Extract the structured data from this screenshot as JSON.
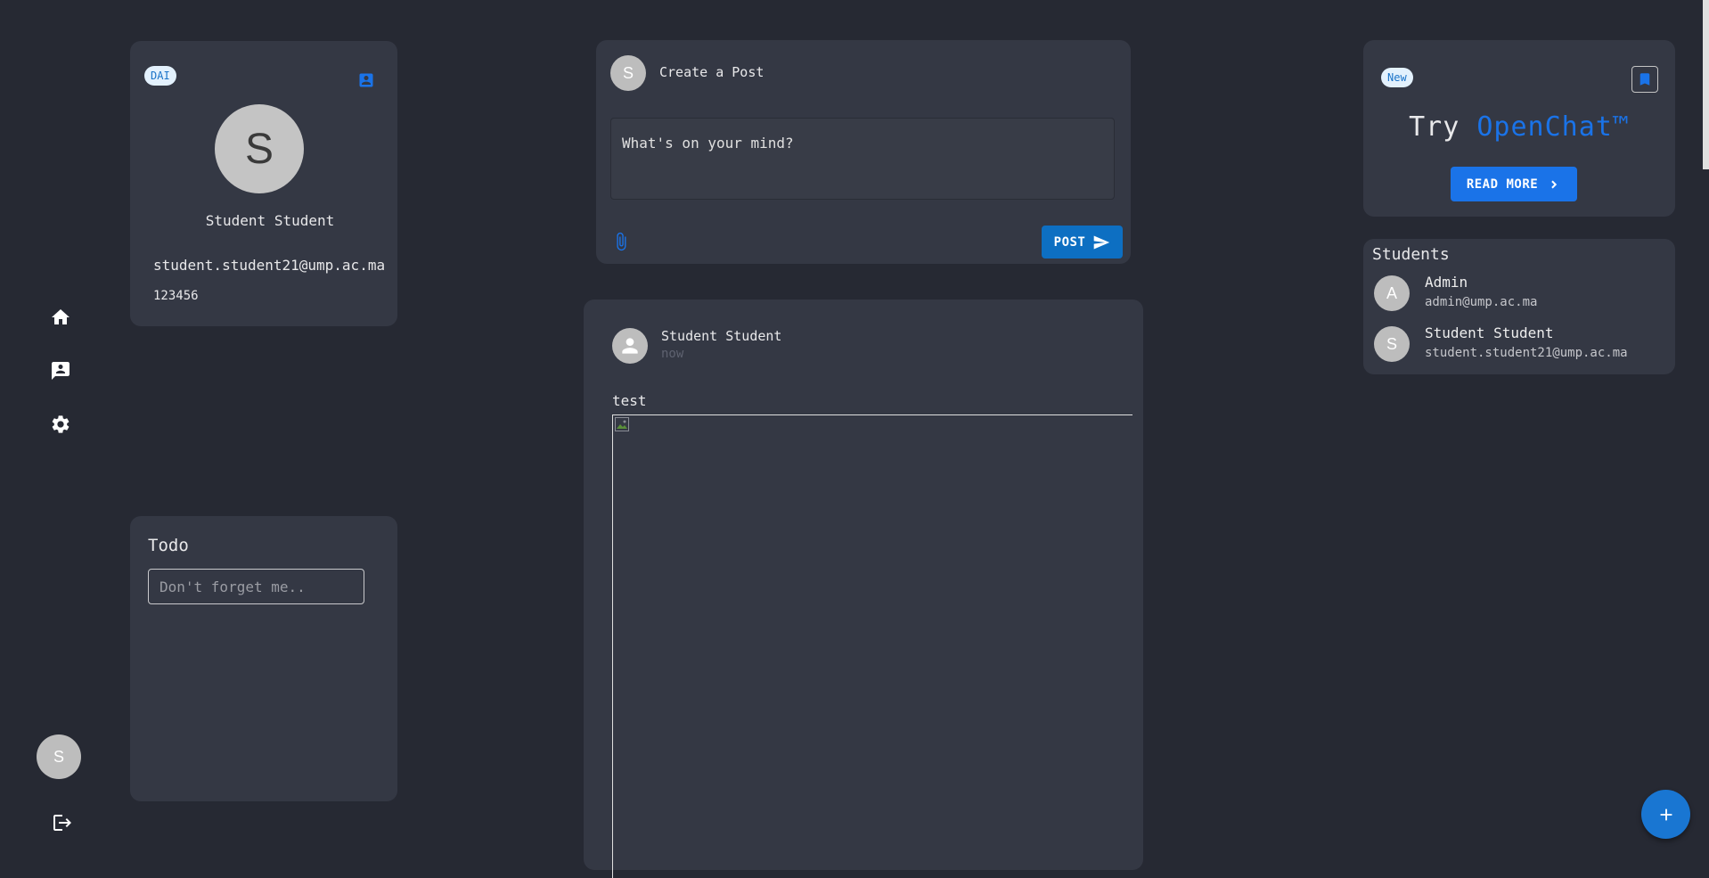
{
  "nav": {
    "items": [
      {
        "icon": "home-icon"
      },
      {
        "icon": "contact-message-icon"
      },
      {
        "icon": "gear-icon"
      }
    ],
    "user_initial": "S",
    "logout_icon": "logout-icon"
  },
  "profile": {
    "badge": "DAI",
    "initial": "S",
    "name": "Student Student",
    "email": "student.student21@ump.ac.ma",
    "id": "123456"
  },
  "todo": {
    "title": "Todo",
    "placeholder": "Don't forget me.."
  },
  "create_post": {
    "initial": "S",
    "title": "Create a Post",
    "placeholder": "What's on your mind?",
    "post_label": "POST"
  },
  "post": {
    "author": "Student Student",
    "time": "now",
    "text": "test"
  },
  "promo": {
    "badge": "New",
    "try_label": "Try",
    "brand": "OpenChat™",
    "read_more_label": "READ MORE"
  },
  "students": {
    "title": "Students",
    "items": [
      {
        "initial": "A",
        "name": "Admin",
        "email": "admin@ump.ac.ma"
      },
      {
        "initial": "S",
        "name": "Student Student",
        "email": "student.student21@ump.ac.ma"
      }
    ]
  },
  "colors": {
    "background": "#262933",
    "card": "#343844",
    "accent": "#1a73e8",
    "post_button": "#0d6fc2"
  }
}
